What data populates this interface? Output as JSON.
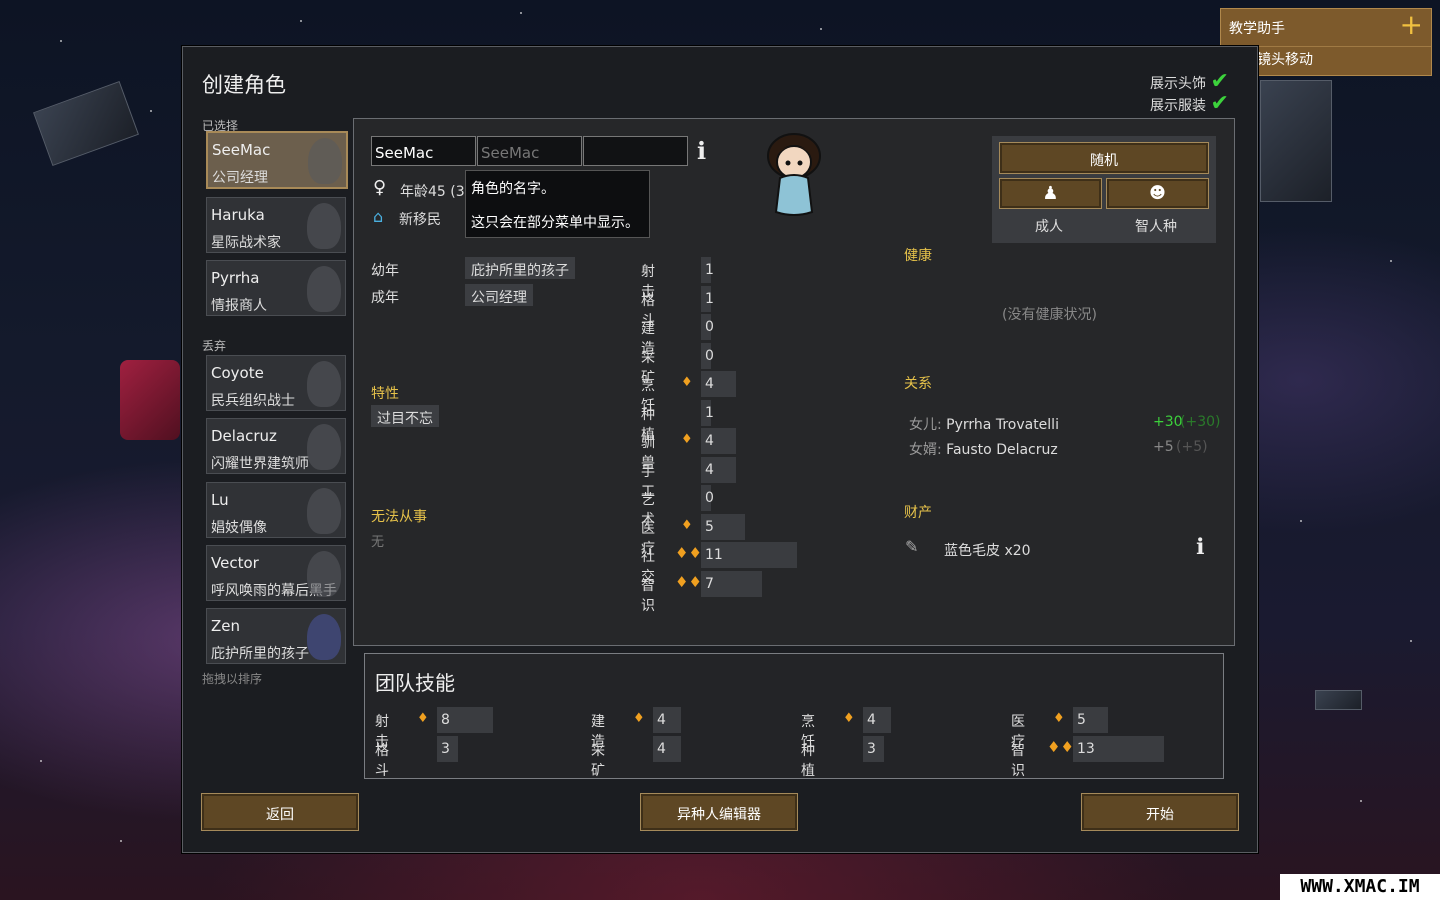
{
  "tutor": {
    "title": "教学助手",
    "item": "地图镜头移动"
  },
  "window": {
    "title": "创建角色",
    "show_headgear": "展示头饰",
    "show_apparel": "展示服装"
  },
  "selected_label": "已选择",
  "discarded_label": "丢弃",
  "drag_hint": "拖拽以排序",
  "selected_pawns": [
    {
      "name": "SeeMac",
      "title": "公司经理"
    },
    {
      "name": "Haruka",
      "title": "星际战术家"
    },
    {
      "name": "Pyrrha",
      "title": "情报商人"
    }
  ],
  "discarded_pawns": [
    {
      "name": "Coyote",
      "title": "民兵组织战士"
    },
    {
      "name": "Delacruz",
      "title": "闪耀世界建筑师"
    },
    {
      "name": "Lu",
      "title": "娼妓偶像"
    },
    {
      "name": "Vector",
      "title": "呼风唤雨的幕后黑手"
    },
    {
      "name": "Zen",
      "title": "庇护所里的孩子"
    }
  ],
  "editor": {
    "first_name": "SeeMac",
    "nick_placeholder": "SeeMac",
    "last_name": "",
    "age": "年龄45 (3",
    "faction": "新移民",
    "tooltip_line1": "角色的名字。",
    "tooltip_line2": "这只会在部分菜单中显示。",
    "random_button": "随机",
    "adult": "成人",
    "sapient": "智人种",
    "childhood_label": "幼年",
    "childhood_value": "庇护所里的孩子",
    "adulthood_label": "成年",
    "adulthood_value": "公司经理",
    "traits_label": "特性",
    "trait1": "过目不忘",
    "incapable_label": "无法从事",
    "incapable_value": "无",
    "health_label": "健康",
    "health_none": "(没有健康状况)",
    "relations_label": "关系",
    "rel1_type": "女儿:",
    "rel1_name": "Pyrrha Trovatelli",
    "rel1_val": "+30",
    "rel1_paren": "(+30)",
    "rel2_type": "女婿:",
    "rel2_name": "Fausto Delacruz",
    "rel2_val": "+5",
    "rel2_paren": "(+5)",
    "possessions_label": "财产",
    "possession1": "蓝色毛皮 x20"
  },
  "skills": [
    {
      "name": "射击",
      "value": "1",
      "passion": 0,
      "level": 1
    },
    {
      "name": "格斗",
      "value": "1",
      "passion": 0,
      "level": 1
    },
    {
      "name": "建造",
      "value": "0",
      "passion": 0,
      "level": 0
    },
    {
      "name": "采矿",
      "value": "0",
      "passion": 0,
      "level": 0
    },
    {
      "name": "烹饪",
      "value": "4",
      "passion": 1,
      "level": 4
    },
    {
      "name": "种植",
      "value": "1",
      "passion": 0,
      "level": 1
    },
    {
      "name": "驯兽",
      "value": "4",
      "passion": 1,
      "level": 4
    },
    {
      "name": "手工",
      "value": "4",
      "passion": 0,
      "level": 4
    },
    {
      "name": "艺术",
      "value": "0",
      "passion": 0,
      "level": 0
    },
    {
      "name": "医疗",
      "value": "5",
      "passion": 1,
      "level": 5
    },
    {
      "name": "社交",
      "value": "11",
      "passion": 2,
      "level": 11
    },
    {
      "name": "智识",
      "value": "7",
      "passion": 2,
      "level": 7
    }
  ],
  "team": {
    "title": "团队技能",
    "skills": [
      {
        "name": "射击",
        "value": "8",
        "passion": 1,
        "level": 8
      },
      {
        "name": "格斗",
        "value": "3",
        "passion": 0,
        "level": 3
      },
      {
        "name": "建造",
        "value": "4",
        "passion": 1,
        "level": 4
      },
      {
        "name": "采矿",
        "value": "4",
        "passion": 0,
        "level": 4
      },
      {
        "name": "烹饪",
        "value": "4",
        "passion": 1,
        "level": 4
      },
      {
        "name": "种植",
        "value": "3",
        "passion": 0,
        "level": 3
      },
      {
        "name": "医疗",
        "value": "5",
        "passion": 1,
        "level": 5
      },
      {
        "name": "智识",
        "value": "13",
        "passion": 2,
        "level": 13
      }
    ]
  },
  "buttons": {
    "back": "返回",
    "xeno": "异种人编辑器",
    "start": "开始"
  },
  "watermark": "WWW.XMAC.IM",
  "colors": {
    "accent_gold": "#e6c24a",
    "button_brown": "#5e4724",
    "check_green": "#3cd23c",
    "positive": "#3cd23c"
  }
}
